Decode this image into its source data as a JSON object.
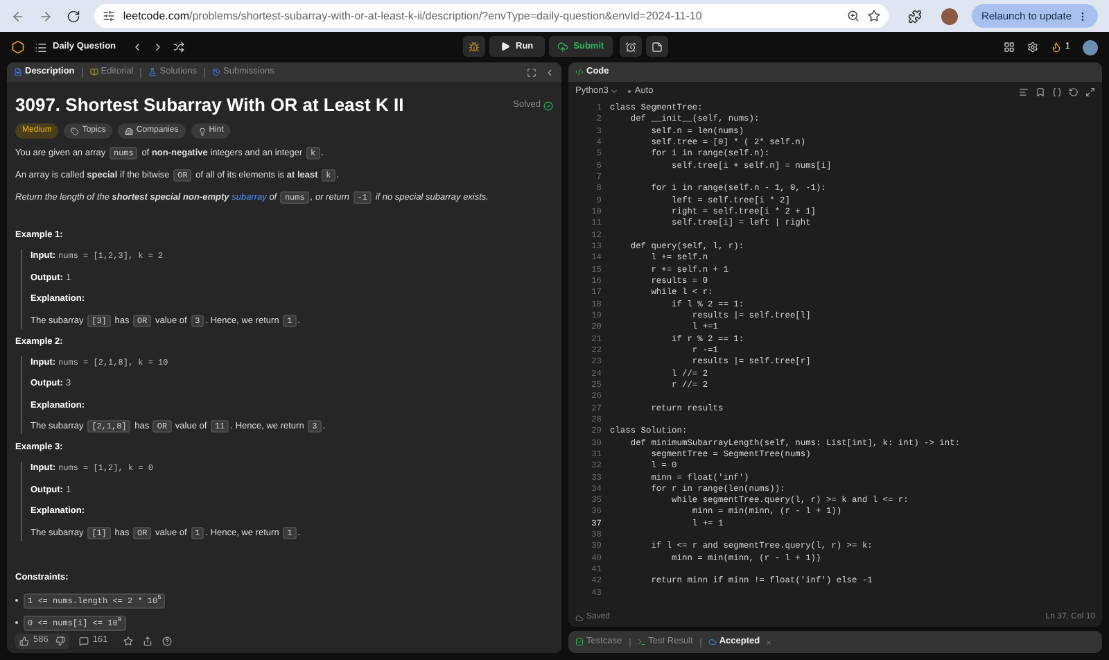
{
  "browser": {
    "url_host": "leetcode.com",
    "url_path": "/problems/shortest-subarray-with-or-at-least-k-ii/description/?envType=daily-question&envId=2024-11-10",
    "relaunch": "Relaunch to update"
  },
  "nav": {
    "title": "Daily Question",
    "run": "Run",
    "submit": "Submit",
    "streak": "1"
  },
  "left_tabs": [
    {
      "label": "Description",
      "kind": "description",
      "selected": true
    },
    {
      "label": "Editorial",
      "kind": "editorial",
      "selected": false
    },
    {
      "label": "Solutions",
      "kind": "solutions",
      "selected": false
    },
    {
      "label": "Submissions",
      "kind": "submissions",
      "selected": false
    }
  ],
  "problem": {
    "title": "3097. Shortest Subarray With OR at Least K II",
    "status": "Solved",
    "tags": [
      {
        "label": "Medium",
        "kind": "difficulty"
      },
      {
        "label": "Topics",
        "kind": "topics"
      },
      {
        "label": "Companies",
        "kind": "companies"
      },
      {
        "label": "Hint",
        "kind": "hint"
      }
    ],
    "paragraphs": [
      {
        "italic": false,
        "parts": [
          {
            "kind": "text",
            "text": "You are given an array "
          },
          {
            "kind": "code",
            "text": "nums"
          },
          {
            "kind": "text",
            "text": " of **non-negative** integers and an integer "
          },
          {
            "kind": "code",
            "text": "k"
          },
          {
            "kind": "text",
            "text": "."
          }
        ]
      },
      {
        "italic": false,
        "parts": [
          {
            "kind": "text",
            "text": "An array is called **special** if the bitwise "
          },
          {
            "kind": "code",
            "text": "OR"
          },
          {
            "kind": "text",
            "text": " of all of its elements is **at least** "
          },
          {
            "kind": "code",
            "text": "k"
          },
          {
            "kind": "text",
            "text": "."
          }
        ]
      },
      {
        "italic": true,
        "parts": [
          {
            "kind": "text",
            "text": "Return the length of the **shortest special non-empty** "
          },
          {
            "kind": "link",
            "text": "subarray"
          },
          {
            "kind": "text",
            "text": " of "
          },
          {
            "kind": "code",
            "text": "nums"
          },
          {
            "kind": "text",
            "text": ", or return "
          },
          {
            "kind": "code",
            "text": "-1"
          },
          {
            "kind": "text",
            "text": " if no special subarray exists."
          }
        ]
      }
    ],
    "examples": [
      {
        "title": "Example 1:",
        "input_label": "Input:",
        "input": "nums = [1,2,3], k = 2",
        "output_label": "Output:",
        "output": "1",
        "explanation_label": "Explanation:",
        "explanation": [
          {
            "kind": "text",
            "text": "The subarray "
          },
          {
            "kind": "code",
            "text": "[3]"
          },
          {
            "kind": "text",
            "text": " has "
          },
          {
            "kind": "code",
            "text": "OR"
          },
          {
            "kind": "text",
            "text": " value of "
          },
          {
            "kind": "code",
            "text": "3"
          },
          {
            "kind": "text",
            "text": ". Hence, we return "
          },
          {
            "kind": "code",
            "text": "1"
          },
          {
            "kind": "text",
            "text": "."
          }
        ]
      },
      {
        "title": "Example 2:",
        "input_label": "Input:",
        "input": "nums = [2,1,8], k = 10",
        "output_label": "Output:",
        "output": "3",
        "explanation_label": "Explanation:",
        "explanation": [
          {
            "kind": "text",
            "text": "The subarray "
          },
          {
            "kind": "code",
            "text": "[2,1,8]"
          },
          {
            "kind": "text",
            "text": " has "
          },
          {
            "kind": "code",
            "text": "OR"
          },
          {
            "kind": "text",
            "text": " value of "
          },
          {
            "kind": "code",
            "text": "11"
          },
          {
            "kind": "text",
            "text": ". Hence, we return "
          },
          {
            "kind": "code",
            "text": "3"
          },
          {
            "kind": "text",
            "text": "."
          }
        ]
      },
      {
        "title": "Example 3:",
        "input_label": "Input:",
        "input": "nums = [1,2], k = 0",
        "output_label": "Output:",
        "output": "1",
        "explanation_label": "Explanation:",
        "explanation": [
          {
            "kind": "text",
            "text": "The subarray "
          },
          {
            "kind": "code",
            "text": "[1]"
          },
          {
            "kind": "text",
            "text": " has "
          },
          {
            "kind": "code",
            "text": "OR"
          },
          {
            "kind": "text",
            "text": " value of "
          },
          {
            "kind": "code",
            "text": "1"
          },
          {
            "kind": "text",
            "text": ". Hence, we return "
          },
          {
            "kind": "code",
            "text": "1"
          },
          {
            "kind": "text",
            "text": "."
          }
        ]
      }
    ],
    "constraints": {
      "title": "Constraints:",
      "items": [
        "1 <= nums.length <= 2 * 10$^{5}$",
        "0 <= nums[i] <= 10$^{9}$"
      ]
    }
  },
  "footer": {
    "likes": "586",
    "comments": "161"
  },
  "code_panel": {
    "tab": "Code",
    "language": "Python3",
    "mode": "Auto",
    "status": "Saved",
    "cursor": "Ln 37, Col 10",
    "lines": [
      {
        "number": "1",
        "text": "class SegmentTree:",
        "current": false
      },
      {
        "number": "2",
        "text": "    def __init__(self, nums):",
        "current": false
      },
      {
        "number": "3",
        "text": "        self.n = len(nums)",
        "current": false
      },
      {
        "number": "4",
        "text": "        self.tree = [0] * ( 2* self.n)",
        "current": false
      },
      {
        "number": "5",
        "text": "        for i in range(self.n):",
        "current": false
      },
      {
        "number": "6",
        "text": "            self.tree[i + self.n] = nums[i]",
        "current": false
      },
      {
        "number": "7",
        "current": false
      },
      {
        "number": "8",
        "text": "        for i in range(self.n - 1, 0, -1):",
        "current": false
      },
      {
        "number": "9",
        "text": "            left = self.tree[i * 2]",
        "current": false
      },
      {
        "number": "10",
        "text": "            right = self.tree[i * 2 + 1]",
        "current": false
      },
      {
        "number": "11",
        "text": "            self.tree[i] = left | right",
        "current": false
      },
      {
        "number": "12",
        "current": false
      },
      {
        "number": "13",
        "text": "    def query(self, l, r):",
        "current": false
      },
      {
        "number": "14",
        "text": "        l += self.n",
        "current": false
      },
      {
        "number": "15",
        "text": "        r += self.n + 1",
        "current": false
      },
      {
        "number": "16",
        "text": "        results = 0",
        "current": false
      },
      {
        "number": "17",
        "text": "        while l < r:",
        "current": false
      },
      {
        "number": "18",
        "text": "            if l % 2 == 1:",
        "current": false
      },
      {
        "number": "19",
        "text": "                results |= self.tree[l]",
        "current": false
      },
      {
        "number": "20",
        "text": "                l +=1",
        "current": false
      },
      {
        "number": "21",
        "text": "            if r % 2 == 1:",
        "current": false
      },
      {
        "number": "22",
        "text": "                r -=1",
        "current": false
      },
      {
        "number": "23",
        "text": "                results |= self.tree[r]",
        "current": false
      },
      {
        "number": "24",
        "text": "            l //= 2",
        "current": false
      },
      {
        "number": "25",
        "text": "            r //= 2",
        "current": false
      },
      {
        "number": "26",
        "current": false
      },
      {
        "number": "27",
        "text": "        return results",
        "current": false
      },
      {
        "number": "28",
        "current": false
      },
      {
        "number": "29",
        "text": "class Solution:",
        "current": false
      },
      {
        "number": "30",
        "text": "    def minimumSubarrayLength(self, nums: List[int], k: int) -> int:",
        "current": false
      },
      {
        "number": "31",
        "text": "        segmentTree = SegmentTree(nums)",
        "current": false
      },
      {
        "number": "32",
        "text": "        l = 0",
        "current": false
      },
      {
        "number": "33",
        "text": "        minn = float('inf')",
        "current": false
      },
      {
        "number": "34",
        "text": "        for r in range(len(nums)):",
        "current": false
      },
      {
        "number": "35",
        "text": "            while segmentTree.query(l, r) >= k and l <= r:",
        "current": false
      },
      {
        "number": "36",
        "text": "                minn = min(minn, (r - l + 1))",
        "current": false
      },
      {
        "number": "37",
        "text": "                l += 1",
        "current": true
      },
      {
        "number": "38",
        "current": false
      },
      {
        "number": "39",
        "text": "        if l <= r and segmentTree.query(l, r) >= k:",
        "current": false
      },
      {
        "number": "40",
        "text": "            minn = min(minn, (r - l + 1))",
        "current": false
      },
      {
        "number": "41",
        "current": false
      },
      {
        "number": "42",
        "text": "        return minn if minn != float('inf') else -1",
        "current": false
      },
      {
        "number": "43",
        "current": false
      }
    ]
  },
  "bottom_tabs": [
    {
      "label": "Testcase",
      "kind": "testcase",
      "selected": false
    },
    {
      "label": "Test Result",
      "kind": "result",
      "selected": false
    },
    {
      "label": "Accepted",
      "kind": "accepted",
      "selected": true
    }
  ]
}
